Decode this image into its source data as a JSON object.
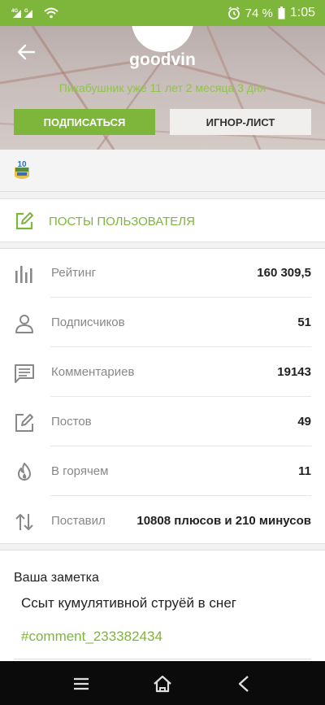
{
  "status_bar": {
    "signal_left": "4G",
    "signal_right": "G",
    "battery_percent": "74 %",
    "time": "1:05",
    "icons": [
      "signal-icon",
      "wifi-icon",
      "alarm-icon",
      "battery-icon"
    ]
  },
  "profile": {
    "username": "goodvin",
    "since": "Пикабушник уже 11 лет 2 месяца 3 дня",
    "subscribe_label": "ПОДПИСАТЬСЯ",
    "ignore_label": "ИГНОР-ЛИСТ"
  },
  "badge": {
    "text": "10"
  },
  "posts_link": {
    "label": "ПОСТЫ ПОЛЬЗОВАТЕЛЯ"
  },
  "stats": [
    {
      "icon": "bar-chart-icon",
      "label": "Рейтинг",
      "value": "160 309,5"
    },
    {
      "icon": "person-icon",
      "label": "Подписчиков",
      "value": "51"
    },
    {
      "icon": "comment-icon",
      "label": "Комментариев",
      "value": "19143"
    },
    {
      "icon": "edit-icon",
      "label": "Постов",
      "value": "49"
    },
    {
      "icon": "flame-icon",
      "label": "В горячем",
      "value": "11"
    },
    {
      "icon": "up-down-arrows-icon",
      "label": "Поставил",
      "value": "10808 плюсов и 210 минусов"
    }
  ],
  "note": {
    "title": "Ваша заметка",
    "text": "Ссыт кумулятивной струёй в снег",
    "link": "#comment_233382434"
  },
  "colors": {
    "accent": "#7db63a",
    "text": "#222222",
    "muted": "#888888",
    "navbar": "#0b0b0b"
  }
}
